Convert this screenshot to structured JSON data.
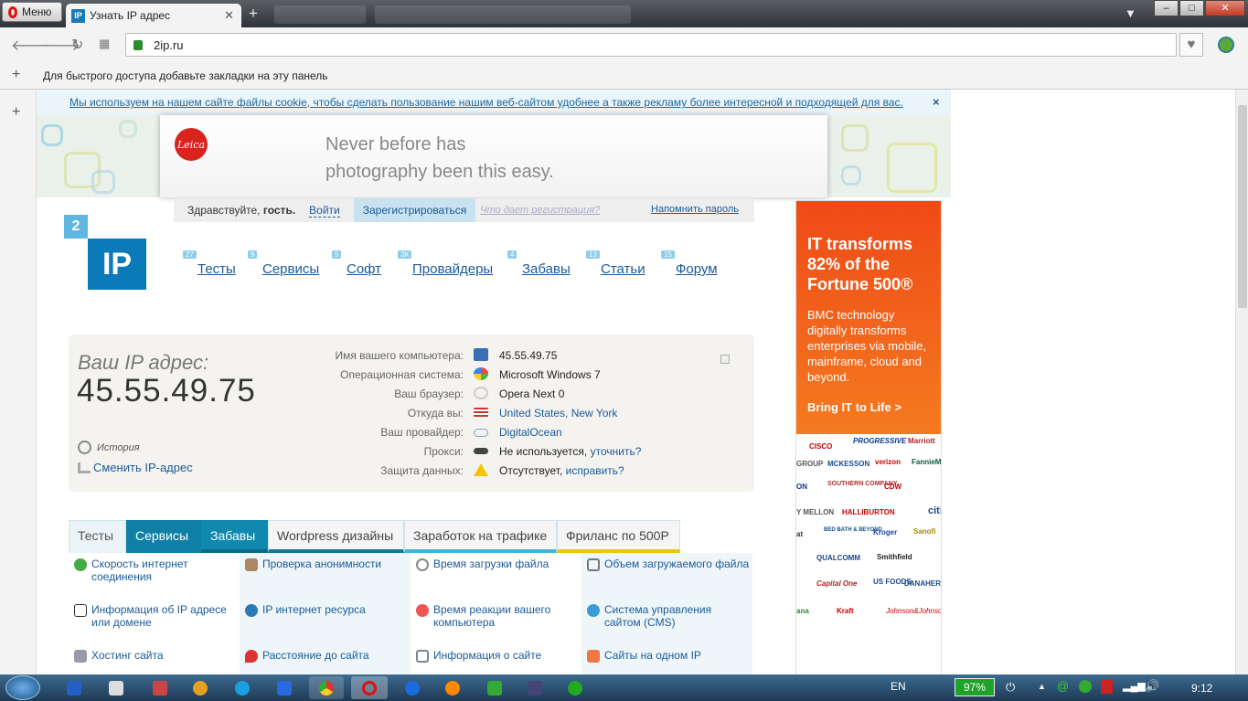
{
  "browser": {
    "menu_label": "Меню",
    "tab_title": "Узнать IP адрес",
    "tab_favicon": "IP",
    "address": "2ip.ru",
    "bookmark_hint": "Для быстрого доступа добавьте закладки на эту панель"
  },
  "cookie": {
    "text": "Мы используем на нашем сайте файлы cookie, чтобы сделать пользование нашим веб-сайтом удобнее а также рекламу более интересной и подходящей для вас.",
    "close": "×"
  },
  "banner": {
    "logo": "Leica",
    "line1": "Never before has",
    "line2": "photography been this easy."
  },
  "login": {
    "hello": "Здравствуйте,",
    "guest": "гость.",
    "login": "Войти",
    "register": "Зарегистрироваться",
    "what": "Что дает регистрация?",
    "remind": "Напомнить пароль"
  },
  "logo": {
    "two": "2",
    "ip": "IP"
  },
  "nav": [
    {
      "label": "Тесты",
      "count": "27"
    },
    {
      "label": "Сервисы",
      "count": "9"
    },
    {
      "label": "Софт",
      "count": "5"
    },
    {
      "label": "Провайдеры",
      "count": "3К"
    },
    {
      "label": "Забавы",
      "count": "4"
    },
    {
      "label": "Статьи",
      "count": "13"
    },
    {
      "label": "Форум",
      "count": "15"
    }
  ],
  "ip": {
    "label": "Ваш IP адрес:",
    "value": "45.55.49.75",
    "history": "История",
    "change": "Сменить IP-адрес"
  },
  "info": [
    {
      "key": "Имя вашего компьютера:",
      "value": "45.55.49.75",
      "icon": "computer-icon",
      "link": ""
    },
    {
      "key": "Операционная система:",
      "value": "Microsoft Windows 7",
      "icon": "windows-icon",
      "link": ""
    },
    {
      "key": "Ваш браузер:",
      "value": "Opera Next 0",
      "icon": "opera-icon",
      "link": ""
    },
    {
      "key": "Откуда вы:",
      "value": "",
      "icon": "us-flag-icon",
      "link": "United States, New York"
    },
    {
      "key": "Ваш провайдер:",
      "value": "",
      "icon": "cloud-icon",
      "link": "DigitalOcean"
    },
    {
      "key": "Прокси:",
      "value": "Не используется,",
      "icon": "glasses-icon",
      "link": "уточнить?"
    },
    {
      "key": "Защита данных:",
      "value": "Отсутствует,",
      "icon": "warning-icon",
      "link": "исправить?"
    }
  ],
  "tabs": [
    "Тесты",
    "Сервисы",
    "Забавы",
    "Wordpress дизайны",
    "Заработок на трафике",
    "Фриланс по 500Р"
  ],
  "services": [
    [
      "Скорость интернет соединения",
      "Проверка анонимности",
      "Время загрузки файла",
      "Объем загружаемого файла"
    ],
    [
      "Информация об IP адресе или домене",
      "IP интернет ресурса",
      "Время реакции вашего компьютера",
      "Система управления сайтом (CMS)"
    ],
    [
      "Хостинг сайта",
      "Расстояние до сайта",
      "Информация о сайте",
      "Сайты на одном IP"
    ]
  ],
  "ad": {
    "headline1": "IT transforms",
    "headline2": "82% of the",
    "headline3": "Fortune 500®",
    "body": "BMC technology digitally transforms enterprises via mobile, mainframe, cloud and beyond.",
    "cta": "Bring IT to Life >",
    "logos": [
      "CISCO",
      "PROGRESSIVE",
      "Marriott",
      "GROUP",
      "MCKESSON",
      "verizon",
      "FannieMae",
      "ON",
      "SOUTHERN COMPANY",
      "CDW",
      "Y MELLON",
      "HALLIBURTON",
      "citi",
      "at",
      "BED BATH & BEYOND",
      "Kroger",
      "Sanofi",
      "QUALCOMM",
      "Smithfield",
      "Capital One",
      "US FOODS",
      "DANAHER",
      "ana",
      "Kraft",
      "Johnson&Johnson"
    ]
  },
  "taskbar": {
    "lang": "EN",
    "battery": "97%",
    "time": "9:12"
  }
}
